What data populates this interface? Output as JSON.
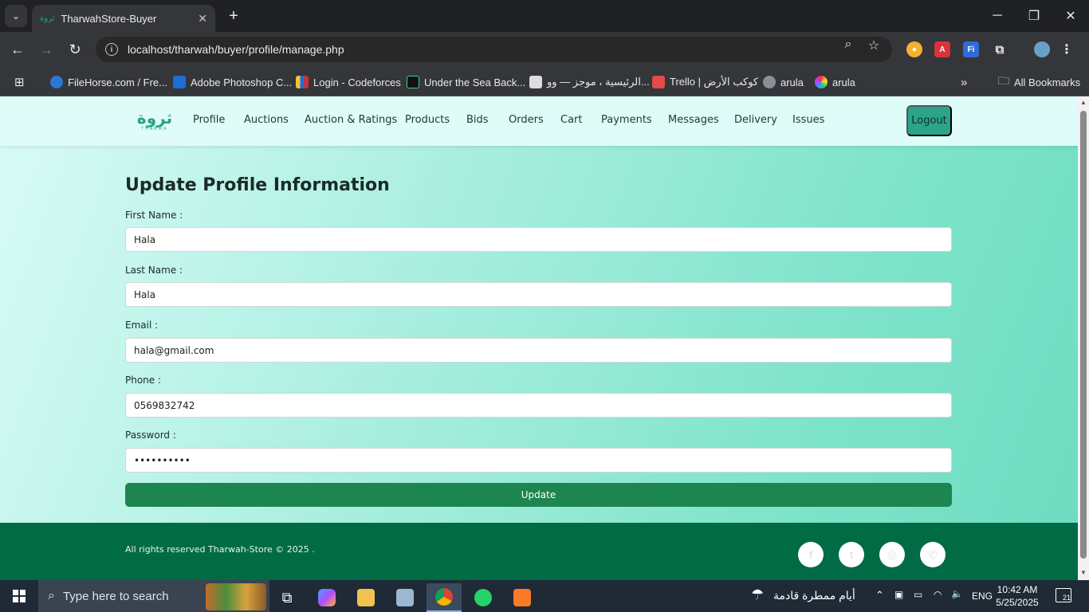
{
  "browser": {
    "tab_title": "TharwahStore-Buyer",
    "tab_favicon": "ثروة",
    "url": "localhost/tharwah/buyer/profile/manage.php",
    "bookmarks": [
      "FileHorse.com / Fre...",
      "Adobe Photoshop C...",
      "Login - Codeforces",
      "Under the Sea Back...",
      "الرئيسية ، موجز — وو...",
      "Trello | كوكب الأرض",
      "arula",
      "arula"
    ],
    "all_bookmarks": "All Bookmarks"
  },
  "site": {
    "logo_ar": "ثروة",
    "logo_en": "THARWA",
    "nav": [
      "Profile",
      "Auctions",
      "Auction & Ratings",
      "Products",
      "Bids",
      "Orders",
      "Cart",
      "Payments",
      "Messages",
      "Delivery",
      "Issues"
    ],
    "logout": "Logout"
  },
  "form": {
    "title": "Update Profile Information",
    "first_name_label": "First Name :",
    "first_name": "Hala",
    "last_name_label": "Last Name :",
    "last_name": "Hala",
    "email_label": "Email :",
    "email": "hala@gmail.com",
    "phone_label": "Phone :",
    "phone": "0569832742",
    "password_label": "Password :",
    "password": "1234567890",
    "submit": "Update"
  },
  "footer": {
    "copyright": "All rights reserved Tharwah-Store © 2025 .",
    "social": [
      "facebook-icon",
      "twitter-icon",
      "instagram-icon",
      "whatsapp-icon"
    ]
  },
  "taskbar": {
    "search_placeholder": "Type here to search",
    "weather": "أيام ممطرة قادمة",
    "language": "ENG",
    "time": "10:42 AM",
    "date": "5/25/2025",
    "notifications": "21"
  },
  "colors": {
    "brand": "#2aa58a",
    "update_button": "#1d8550",
    "footer": "#006b44"
  }
}
